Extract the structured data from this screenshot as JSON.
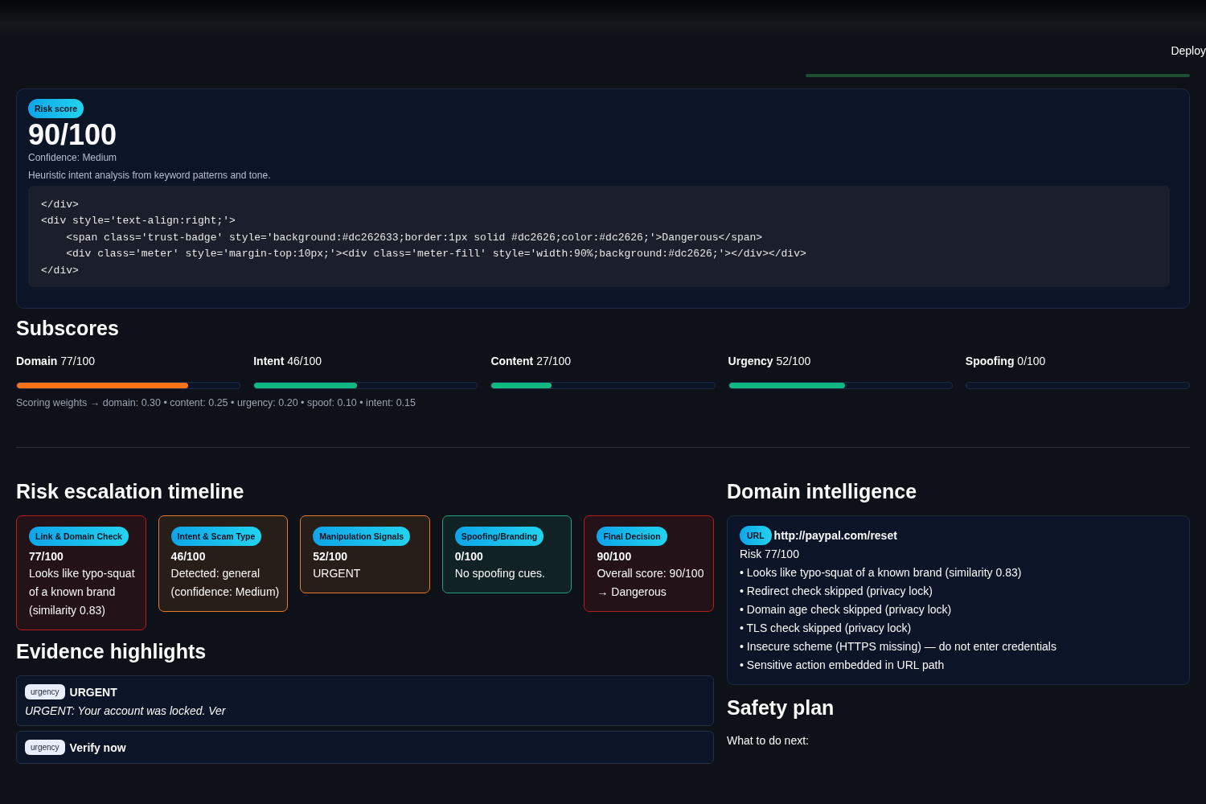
{
  "header": {
    "deploy": "Deploy"
  },
  "risk": {
    "badge": "Risk score",
    "score": "90/100",
    "confidence": "Confidence: Medium",
    "note": "Heuristic intent analysis from keyword patterns and tone.",
    "code": [
      "</div>",
      "<div style='text-align:right;'>",
      "    <span class='trust-badge' style='background:#dc262633;border:1px solid #dc2626;color:#dc2626;'>Dangerous</span>",
      "    <div class='meter' style='margin-top:10px;'><div class='meter-fill' style='width:90%;background:#dc2626;'></div></div>",
      "</div>"
    ]
  },
  "subscores": {
    "title": "Subscores",
    "items": [
      {
        "name": "Domain",
        "value": "77/100",
        "level": 0.77,
        "color": "#f97316"
      },
      {
        "name": "Intent",
        "value": "46/100",
        "level": 0.46,
        "color": "#10b981"
      },
      {
        "name": "Content",
        "value": "27/100",
        "level": 0.27,
        "color": "#10b981"
      },
      {
        "name": "Urgency",
        "value": "52/100",
        "level": 0.52,
        "color": "#10b981"
      },
      {
        "name": "Spoofing",
        "value": "0/100",
        "level": 0
      }
    ],
    "weights": "Scoring weights → domain: 0.30 • content: 0.25 • urgency: 0.20 • spoof: 0.10 • intent: 0.15"
  },
  "timeline": {
    "title": "Risk escalation timeline",
    "steps": [
      {
        "label": "Link & Domain Check",
        "score": "77/100",
        "text": "Looks like typo-squat of a known brand (similarity 0.83)",
        "color": "#b91c1c"
      },
      {
        "label": "Intent & Scam Type",
        "score": "46/100",
        "text": "Detected: general (confidence: Medium)",
        "color": "#ea7a2a"
      },
      {
        "label": "Manipulation Signals",
        "score": "52/100",
        "text": "URGENT",
        "color": "#ea7a2a"
      },
      {
        "label": "Spoofing/Branding",
        "score": "0/100",
        "text": "No spoofing cues.",
        "color": "#21a27a"
      },
      {
        "label": "Final Decision",
        "score": "90/100",
        "text": "Overall score: 90/100 → Dangerous",
        "color": "#b91c1c"
      }
    ]
  },
  "evidence": {
    "title": "Evidence highlights",
    "items": [
      {
        "tag": "urgency",
        "heading": "URGENT",
        "quote": "URGENT: Your account was locked. Ver"
      },
      {
        "tag": "urgency",
        "heading": "Verify now"
      }
    ]
  },
  "domain": {
    "title": "Domain intelligence",
    "badge": "URL",
    "url": "http://paypal.com/reset",
    "risk": "Risk 77/100",
    "points": [
      "• Looks like typo-squat of a known brand (similarity 0.83)",
      "• Redirect check skipped (privacy lock)",
      "• Domain age check skipped (privacy lock)",
      "• TLS check skipped (privacy lock)",
      "• Insecure scheme (HTTPS missing) — do not enter credentials",
      "• Sensitive action embedded in URL path"
    ]
  },
  "safety": {
    "title": "Safety plan",
    "intro": "What to do next:"
  }
}
